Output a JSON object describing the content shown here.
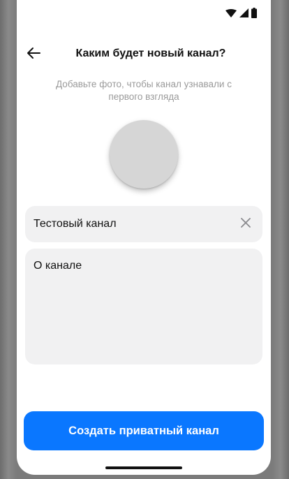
{
  "status_bar": {
    "icons": [
      "wifi-icon",
      "cellular-signal-icon",
      "battery-icon"
    ]
  },
  "header": {
    "back_icon": "arrow-left-icon",
    "title": "Каким будет новый канал?"
  },
  "subtitle": "Добавьте фото, чтобы канал узнавали с первого взгляда",
  "form": {
    "name_value": "Тестовый канал",
    "clear_icon": "close-icon",
    "about_placeholder": "О канале",
    "about_value": ""
  },
  "create_button": {
    "label": "Создать приватный канал"
  },
  "colors": {
    "accent": "#0a77ff",
    "field_bg": "#f1f1f2",
    "avatar_placeholder": "#d6d6d6",
    "subtitle_text": "#9a9a9a"
  }
}
